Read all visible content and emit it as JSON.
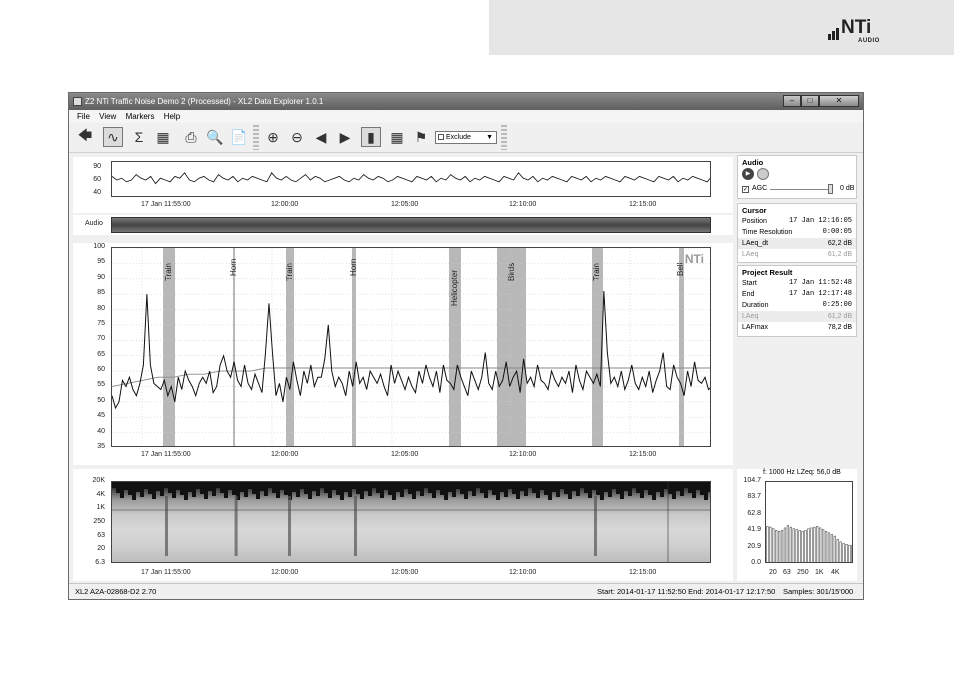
{
  "brand": {
    "word": "NTi",
    "sub": "AUDIO"
  },
  "window": {
    "title": "Z2 NTi Traffic Noise Demo 2 (Processed) - XL2 Data Explorer 1.0.1"
  },
  "menu": [
    "File",
    "View",
    "Markers",
    "Help"
  ],
  "toolbar": {
    "icons": [
      "back-arrow-icon",
      "chart-icon",
      "sum-icon",
      "grid-icon",
      "print-icon",
      "print-preview-icon",
      "report-icon",
      "zoom-in-icon",
      "zoom-out-icon",
      "pan-left-icon",
      "pan-right-icon",
      "spectrum-icon",
      "table-icon",
      "marker-flag-icon"
    ],
    "marker_mode": "Exclude"
  },
  "overview": {
    "yticks": [
      "90",
      "60",
      "40"
    ]
  },
  "time_ticks": [
    "17 Jan 11:55:00",
    "12:00:00",
    "12:05:00",
    "12:10:00",
    "12:15:00"
  ],
  "audio_track_label": "Audio",
  "watermark": "NTi",
  "markers": [
    {
      "label": "Train",
      "pos": 0.085,
      "w": 0.02
    },
    {
      "label": "Horn",
      "pos": 0.201,
      "w": 0.004
    },
    {
      "label": "Train",
      "pos": 0.29,
      "w": 0.014
    },
    {
      "label": "Horn",
      "pos": 0.4,
      "w": 0.006
    },
    {
      "label": "Helicopter",
      "pos": 0.562,
      "w": 0.02
    },
    {
      "label": "Birds",
      "pos": 0.642,
      "w": 0.048
    },
    {
      "label": "Train",
      "pos": 0.8,
      "w": 0.018
    },
    {
      "label": "Bell",
      "pos": 0.945,
      "w": 0.008
    }
  ],
  "main_chart": {
    "yticks": [
      "100",
      "95",
      "90",
      "85",
      "80",
      "75",
      "70",
      "65",
      "60",
      "55",
      "50",
      "45",
      "40",
      "35"
    ]
  },
  "spectrogram": {
    "yticks": [
      "20K",
      "4K",
      "1K",
      "250",
      "63",
      "20",
      "6.3"
    ]
  },
  "spectrum": {
    "header": "f: 1000 Hz   LZeq: 56,0 dB",
    "yticks": [
      "104.7",
      "83.7",
      "62.8",
      "41.9",
      "20.9",
      "0.0"
    ],
    "xticks": [
      "20",
      "63",
      "250",
      "1K",
      "4K"
    ],
    "bar_heights_pct": [
      46,
      45,
      43,
      41,
      40,
      41,
      44,
      47,
      45,
      43,
      42,
      41,
      40,
      41,
      43,
      44,
      45,
      46,
      44,
      42,
      40,
      38,
      36,
      34,
      30,
      27,
      25,
      24,
      23,
      23
    ]
  },
  "chart_data": [
    {
      "type": "line",
      "title": "",
      "xlabel": "",
      "ylabel": "",
      "xticks": [
        "17 Jan 11:55:00",
        "12:00:00",
        "12:05:00",
        "12:10:00",
        "12:15:00"
      ],
      "ylim": [
        35,
        100
      ],
      "series": [
        {
          "name": "",
          "values": [
            52,
            48,
            50,
            57,
            55,
            58,
            54,
            52,
            56,
            62,
            85,
            62,
            56,
            55,
            54,
            57,
            52,
            55,
            50,
            58,
            54,
            60,
            57,
            55,
            52,
            56,
            58,
            56,
            60,
            53,
            55,
            62,
            65,
            60,
            58,
            63,
            57,
            55,
            62,
            56,
            54,
            59,
            56,
            53,
            66,
            82,
            66,
            52,
            56,
            50,
            58,
            54,
            63,
            57,
            52,
            60,
            56,
            62,
            55,
            58,
            58,
            64,
            75,
            60,
            55,
            58,
            56,
            52,
            60,
            55,
            63,
            56,
            58,
            54,
            60,
            58,
            56,
            59,
            55,
            52,
            62,
            56,
            60,
            57,
            54,
            58,
            55,
            53,
            60,
            56,
            62,
            58,
            55,
            60,
            53,
            62,
            57,
            56,
            54,
            62,
            58,
            55,
            52,
            60,
            57,
            54,
            58,
            66,
            56,
            54,
            60,
            55,
            57,
            63,
            55,
            58,
            60,
            53,
            64,
            56,
            58,
            55,
            62,
            57,
            56,
            54,
            60,
            57,
            55,
            58,
            56,
            60,
            53,
            62,
            57,
            54,
            60,
            58,
            56,
            59,
            55,
            86,
            66,
            56,
            58,
            55,
            60,
            54,
            57,
            62,
            56,
            54,
            58,
            55,
            60,
            53,
            57,
            60,
            66,
            55,
            54,
            62,
            58,
            56,
            52,
            60,
            55,
            63,
            57,
            56,
            58,
            54,
            55
          ]
        },
        {
          "name": "",
          "values": [
            55,
            56,
            57,
            58,
            58,
            59,
            59,
            60,
            60,
            60,
            61,
            61,
            61,
            61,
            61,
            61,
            61,
            61,
            61,
            61,
            61,
            61,
            61,
            61,
            61,
            61,
            61,
            61,
            61,
            61,
            61,
            61,
            61,
            61,
            61,
            61,
            61,
            61,
            61,
            61
          ]
        }
      ]
    }
  ],
  "overview_trace": [
    62,
    60,
    61,
    59,
    60,
    63,
    61,
    60,
    62,
    58,
    61,
    60,
    59,
    62,
    61,
    64,
    60,
    59,
    61,
    62,
    60,
    59,
    63,
    61,
    60,
    62,
    59,
    61,
    60,
    62,
    61,
    60,
    59,
    64,
    61,
    60,
    62,
    60,
    59,
    61,
    63,
    60,
    62,
    61,
    59,
    60,
    61,
    62,
    60,
    59,
    61,
    60,
    63,
    61,
    60,
    62,
    61,
    59,
    60,
    62,
    61,
    60,
    59,
    62,
    61,
    60,
    62,
    59,
    61,
    60,
    63,
    61,
    60,
    62,
    59,
    61,
    60,
    62,
    61,
    60,
    59,
    62,
    61,
    60,
    64,
    61,
    60,
    62,
    59,
    61,
    60,
    62,
    61,
    60,
    59,
    62,
    61,
    60,
    62,
    59,
    61,
    60,
    62,
    61,
    60,
    59,
    62,
    61,
    60,
    62,
    61,
    60,
    59,
    62,
    61,
    60,
    62,
    59,
    61,
    60,
    62,
    61,
    60,
    59,
    62
  ],
  "audio_panel": {
    "title": "Audio",
    "agc_label": "AGC",
    "gain": "0 dB"
  },
  "cursor_panel": {
    "title": "Cursor",
    "rows": [
      {
        "k": "Position",
        "v": "17 Jan 12:16:05"
      },
      {
        "k": "Time Resolution",
        "v": "0:00:05"
      },
      {
        "k": "LAeq_dt",
        "v": "62,2 dB"
      },
      {
        "k": "LAeq",
        "v": "61,2 dB"
      }
    ]
  },
  "project_panel": {
    "title": "Project Result",
    "rows": [
      {
        "k": "Start",
        "v": "17 Jan 11:52:48"
      },
      {
        "k": "End",
        "v": "17 Jan 12:17:48"
      },
      {
        "k": "Duration",
        "v": "0:25:00"
      },
      {
        "k": "LAeq",
        "v": "61,2 dB"
      },
      {
        "k": "LAFmax",
        "v": "78,2 dB"
      }
    ]
  },
  "status": {
    "device": "XL2 A2A-02868-D2 2.70",
    "range": "Start: 2014-01-17 11:52:50 End: 2014-01-17 12:17:50",
    "samples": "Samples: 301/15'000"
  }
}
